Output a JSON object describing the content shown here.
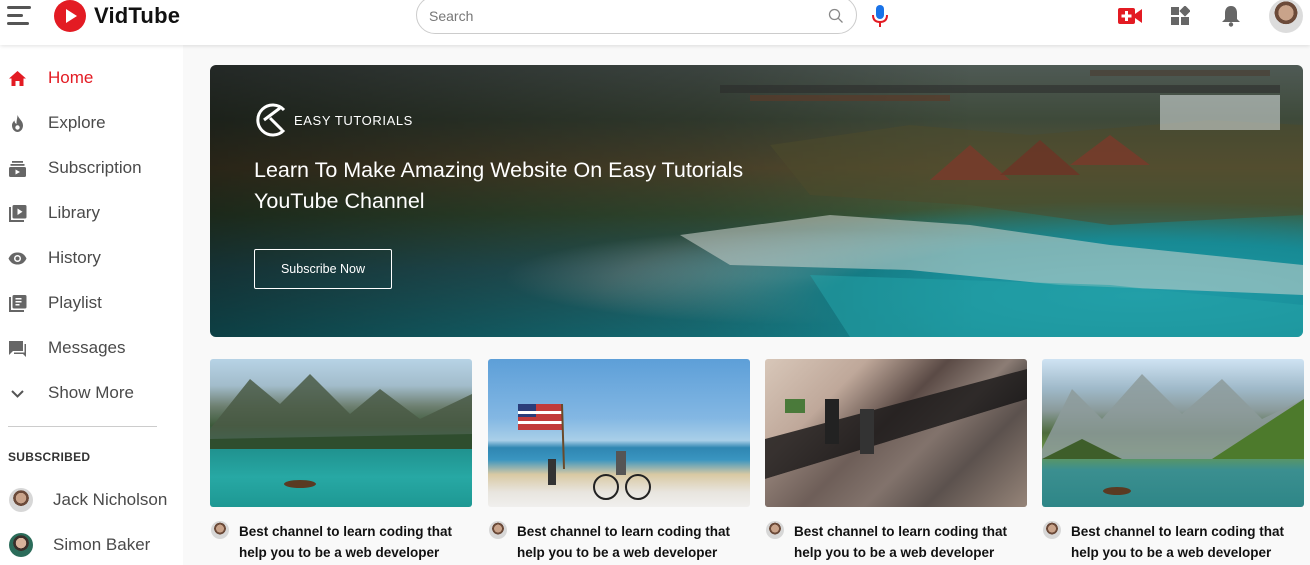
{
  "app": {
    "name": "VidTube"
  },
  "search": {
    "placeholder": "Search"
  },
  "sidebar": {
    "items": [
      {
        "label": "Home",
        "icon": "home-icon",
        "active": true
      },
      {
        "label": "Explore",
        "icon": "explore-icon"
      },
      {
        "label": "Subscription",
        "icon": "subscription-icon"
      },
      {
        "label": "Library",
        "icon": "library-icon"
      },
      {
        "label": "History",
        "icon": "history-icon"
      },
      {
        "label": "Playlist",
        "icon": "playlist-icon"
      },
      {
        "label": "Messages",
        "icon": "messages-icon"
      },
      {
        "label": "Show More",
        "icon": "chevron-down-icon"
      }
    ],
    "subscribed_heading": "SUBSCRIBED",
    "subscribed": [
      {
        "name": "Jack Nicholson"
      },
      {
        "name": "Simon Baker"
      }
    ]
  },
  "banner": {
    "brand": "EASY TUTORIALS",
    "title_line1": "Learn To Make Amazing Website On Easy Tutorials",
    "title_line2": "YouTube Channel",
    "button": "Subscribe Now"
  },
  "videos": [
    {
      "title_line1": "Best channel to learn coding that",
      "title_line2": "help you to be a web developer"
    },
    {
      "title_line1": "Best channel to learn coding that",
      "title_line2": "help you to be a web developer"
    },
    {
      "title_line1": "Best channel to learn coding that",
      "title_line2": "help you to be a web developer"
    },
    {
      "title_line1": "Best channel to learn coding that",
      "title_line2": "help you to be a web developer"
    }
  ],
  "colors": {
    "accent": "#e31b23",
    "mic": "#1a73e8"
  }
}
